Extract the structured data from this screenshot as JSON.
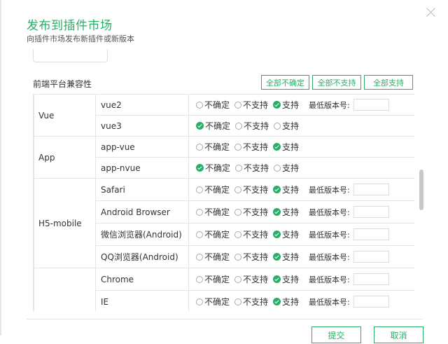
{
  "dialog": {
    "title": "发布到插件市场",
    "subtitle": "向插件市场发布新插件或新版本"
  },
  "compat": {
    "section_label": "前端平台兼容性",
    "buttons": {
      "all_uncertain": "全部不确定",
      "all_unsupported": "全部不支持",
      "all_supported": "全部支持"
    },
    "option_labels": {
      "uncertain": "不确定",
      "unsupported": "不支持",
      "supported": "支持"
    },
    "min_version_label": "最低版本号:",
    "groups": [
      {
        "platform": "Vue",
        "items": [
          {
            "name": "vue2",
            "value": "supported",
            "show_version": true
          },
          {
            "name": "vue3",
            "value": "uncertain",
            "show_version": false
          }
        ]
      },
      {
        "platform": "App",
        "items": [
          {
            "name": "app-vue",
            "value": "supported",
            "show_version": false
          },
          {
            "name": "app-nvue",
            "value": "uncertain",
            "show_version": false
          }
        ]
      },
      {
        "platform": "H5-mobile",
        "items": [
          {
            "name": "Safari",
            "value": "supported",
            "show_version": true
          },
          {
            "name": "Android Browser",
            "value": "supported",
            "show_version": true
          },
          {
            "name": "微信浏览器(Android)",
            "value": "supported",
            "show_version": true
          },
          {
            "name": "QQ浏览器(Android)",
            "value": "supported",
            "show_version": true
          }
        ]
      },
      {
        "platform": "",
        "items": [
          {
            "name": "Chrome",
            "value": "supported",
            "show_version": true
          },
          {
            "name": "IE",
            "value": "supported",
            "show_version": true
          }
        ]
      }
    ]
  },
  "footer": {
    "submit": "提交",
    "cancel": "取消"
  }
}
